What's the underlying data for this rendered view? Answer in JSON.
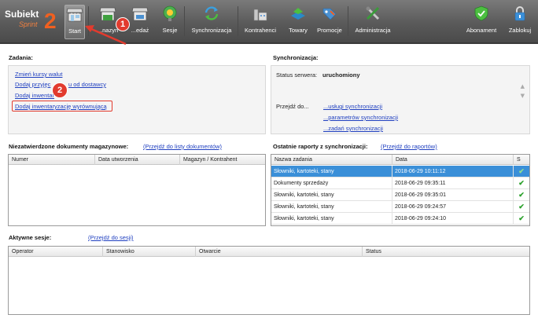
{
  "app": {
    "logo_name": "Subiekt",
    "logo_sub": "Sprint",
    "logo_number": "2"
  },
  "toolbar": {
    "buttons": [
      {
        "label": "Start",
        "icon": "storefront-icon"
      },
      {
        "label": "Magazyn",
        "icon": "warehouse-icon"
      },
      {
        "label": "Sprzedaż",
        "icon": "cash-register-icon"
      },
      {
        "label": "Sesje",
        "icon": "session-icon"
      },
      {
        "label": "Synchronizacja",
        "icon": "sync-icon"
      },
      {
        "label": "Kontrahenci",
        "icon": "contractors-icon"
      },
      {
        "label": "Towary",
        "icon": "goods-icon"
      },
      {
        "label": "Promocje",
        "icon": "promotions-tag-icon"
      },
      {
        "label": "Administracja",
        "icon": "admin-tools-icon"
      },
      {
        "label": "Abonament",
        "icon": "subscription-shield-icon"
      },
      {
        "label": "Zablokuj",
        "icon": "lock-icon"
      }
    ],
    "visible_labels": {
      "start": "Start",
      "magazyn": "...nazyn",
      "sprzedaz": "...edaż",
      "sesje": "Sesje",
      "synchronizacja": "Synchronizacja",
      "kontrahenci": "Kontrahenci",
      "towary": "Towary",
      "promocje": "Promocje",
      "administracja": "Administracja",
      "abonament": "Abonament",
      "zablokuj": "Zablokuj"
    }
  },
  "callouts": {
    "one": "1",
    "two": "2"
  },
  "zadania": {
    "title": "Zadania:",
    "links": [
      "Zmień kursy walut",
      "Dodaj przyjęcie towaru od dostawcy",
      "Dodaj inwentaryzację",
      "Dodaj inwentaryzację wyrównującą"
    ],
    "visible": {
      "l1": "Zmień kursy walut",
      "l2": "Dodaj przyjęc",
      "l2b": "u od dostawcy",
      "l3": "Dodaj inwentar",
      "l4": "Dodaj inwentaryzację wyrównującą"
    }
  },
  "synchronizacja": {
    "title": "Synchronizacja:",
    "status_label": "Status serwera:",
    "status_value": "uruchomiony",
    "goto_label": "Przejdź do...",
    "links": [
      "...usługi synchronizacji",
      "...parametrów synchronizacji",
      "...zadań synchronizacji"
    ]
  },
  "documents": {
    "title": "Niezatwierdzone dokumenty magazynowe:",
    "link": "(Przejdź do listy dokumentów)",
    "columns": [
      "Numer",
      "Data utworzenia",
      "Magazyn / Kontrahent"
    ]
  },
  "reports": {
    "title": "Ostatnie raporty z synchronizacji:",
    "link": "(Przejdź do raportów)",
    "columns": [
      "Nazwa zadania",
      "Data",
      "S"
    ],
    "rows": [
      {
        "name": "Słowniki, kartoteki, stany",
        "date": "2018-06-29 10:11:12",
        "status": "✔"
      },
      {
        "name": "Dokumenty sprzedaży",
        "date": "2018-06-29 09:35:11",
        "status": "✔"
      },
      {
        "name": "Słowniki, kartoteki, stany",
        "date": "2018-06-29 09:35:01",
        "status": "✔"
      },
      {
        "name": "Słowniki, kartoteki, stany",
        "date": "2018-06-29 09:24:57",
        "status": "✔"
      },
      {
        "name": "Słowniki, kartoteki, stany",
        "date": "2018-06-29 09:24:10",
        "status": "✔"
      }
    ]
  },
  "sessions": {
    "title": "Aktywne sesje:",
    "link": "(Przejdź do sesji)",
    "columns": [
      "Operator",
      "Stanowisko",
      "Otwarcie",
      "Status"
    ]
  },
  "colors": {
    "toolbar_bg": "#5f5f5f",
    "link": "#2040c0",
    "selection": "#3a8fd8",
    "callout": "#e23b2e",
    "check": "#2aa02a"
  }
}
